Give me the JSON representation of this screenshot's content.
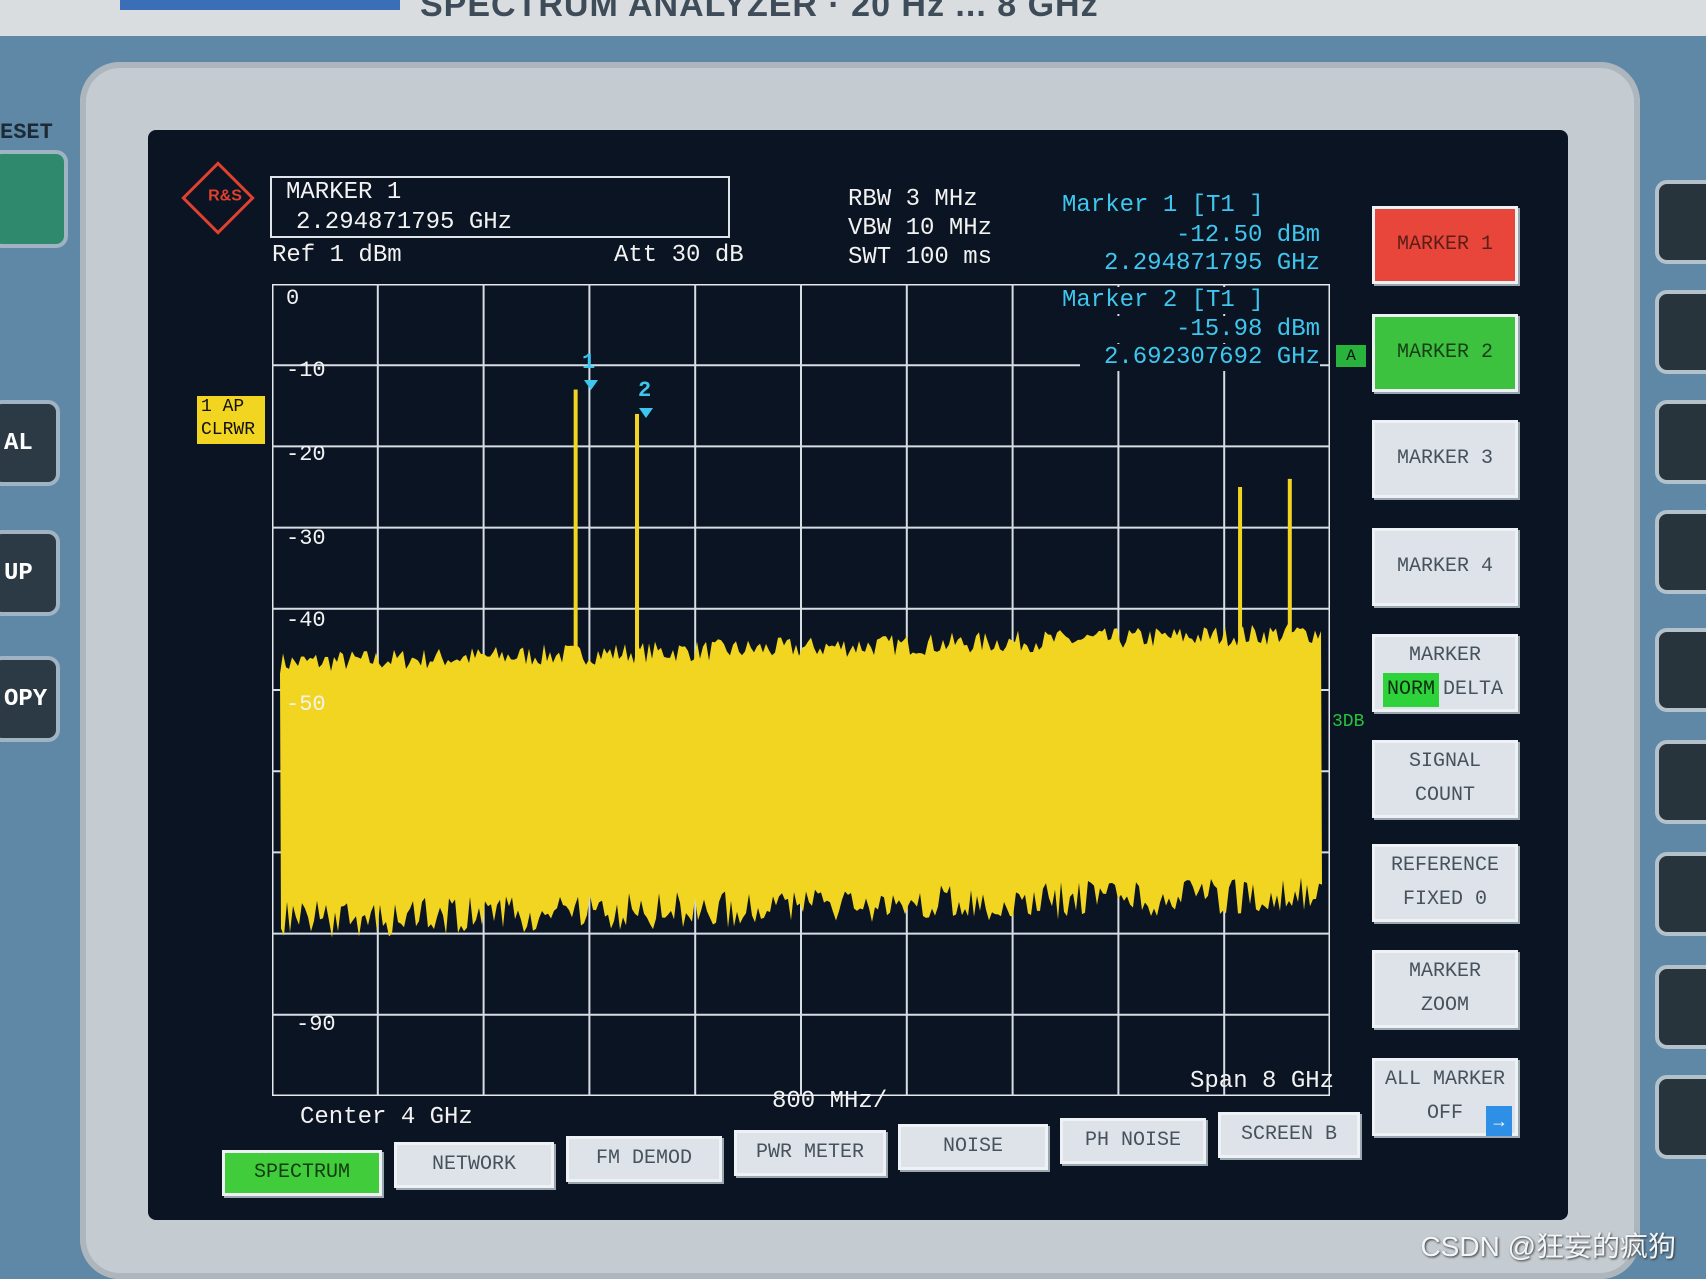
{
  "device": {
    "title": "SPECTRUM ANALYZER · 20 Hz ... 8 GHz"
  },
  "left_keys": {
    "preset": "ESET",
    "k1": "AL",
    "k2": "UP",
    "k3": "OPY"
  },
  "marker_box": {
    "line1": "MARKER 1",
    "line2": "2.294871795 GHz"
  },
  "settings": {
    "ref": "Ref  1 dBm",
    "att": "Att  30 dB",
    "rbw": "RBW 3 MHz",
    "vbw": "VBW 10 MHz",
    "swt": "SWT 100 ms"
  },
  "readouts": {
    "m1_title": "Marker 1 [T1 ]",
    "m1_level": "-12.50 dBm",
    "m1_freq": "2.294871795 GHz",
    "m2_title": "Marker 2 [T1 ]",
    "m2_level": "-15.98 dBm",
    "m2_freq": "2.692307692 GHz"
  },
  "trace_badges": {
    "ap": "1 AP",
    "clrwr": "CLRWR",
    "a": "A",
    "db3": "3DB"
  },
  "y_axis": [
    "0",
    "-10",
    "-20",
    "-30",
    "-40",
    "-50",
    "-90"
  ],
  "bottom": {
    "center": "Center  4 GHz",
    "div": "800 MHz/",
    "span": "Span  8 GHz"
  },
  "softkeys": {
    "m1": "MARKER 1",
    "m2": "MARKER 2",
    "m3": "MARKER 3",
    "m4": "MARKER 4",
    "marker": "MARKER",
    "norm": "NORM",
    "delta": "DELTA",
    "signal": "SIGNAL",
    "count": "COUNT",
    "reference": "REFERENCE",
    "fixed": "FIXED  0",
    "marker_zoom1": "MARKER",
    "marker_zoom2": "ZOOM",
    "all_marker": "ALL MARKER",
    "off": "OFF",
    "arrow": "→"
  },
  "tabs": [
    "SPECTRUM",
    "NETWORK",
    "FM DEMOD",
    "PWR METER",
    "NOISE",
    "PH NOISE",
    "SCREEN B"
  ],
  "markers": [
    {
      "num": "1"
    },
    {
      "num": "2"
    }
  ],
  "watermark": "CSDN @狂妄的疯狗",
  "colors": {
    "trace": "#f1d521",
    "marker": "#3ec6ee",
    "active": "#41cc3b",
    "marker1_key": "#e9463b"
  }
}
